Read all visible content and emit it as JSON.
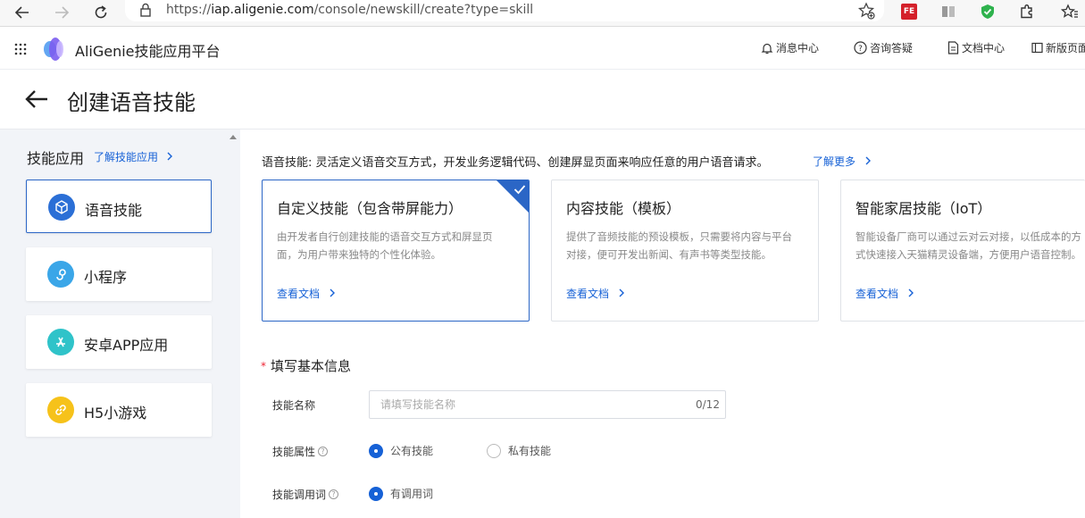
{
  "browser": {
    "url_prefix": "https://",
    "url_host": "iap.aligenie.com",
    "url_path": "/console/newskill/create?type=skill",
    "ext_badge": "FE"
  },
  "header": {
    "brand": "AliGenie技能应用平台",
    "nav": [
      "消息中心",
      "咨询答疑",
      "文档中心",
      "新版页面"
    ]
  },
  "page": {
    "title": "创建语音技能"
  },
  "sidebar": {
    "heading": "技能应用",
    "learn_link": "了解技能应用",
    "items": [
      {
        "label": "语音技能",
        "color": "#2b6fd6"
      },
      {
        "label": "小程序",
        "color": "#3aa6e8"
      },
      {
        "label": "安卓APP应用",
        "color": "#2fc3c9"
      },
      {
        "label": "H5小游戏",
        "color": "#f6c21a"
      }
    ]
  },
  "main": {
    "intro": "语音技能: 灵活定义语音交互方式，开发业务逻辑代码、创建屏显页面来响应任意的用户语音请求。",
    "intro_link": "了解更多",
    "cards": [
      {
        "title": "自定义技能（包含带屏能力）",
        "desc": "由开发者自行创建技能的语音交互方式和屏显页面，为用户带来独特的个性化体验。",
        "doc": "查看文档"
      },
      {
        "title": "内容技能（模板）",
        "desc": "提供了音频技能的预设模板，只需要将内容与平台对接，便可开发出新闻、有声书等类型技能。",
        "doc": "查看文档"
      },
      {
        "title": "智能家居技能（IoT）",
        "desc": "智能设备厂商可以通过云对云对接，以低成本的方式快速接入天猫精灵设备端，方便用户语音控制。",
        "doc": "查看文档"
      }
    ],
    "form": {
      "section": "填写基本信息",
      "name_label": "技能名称",
      "name_placeholder": "请填写技能名称",
      "name_counter": "0/12",
      "attr_label": "技能属性",
      "attr_options": [
        "公有技能",
        "私有技能"
      ],
      "invoke_label": "技能调用词",
      "invoke_option": "有调用词"
    }
  },
  "colors": {
    "accent": "#2b66c6",
    "link": "#1661d6",
    "sidebar_bg": "#f2f4f8"
  }
}
